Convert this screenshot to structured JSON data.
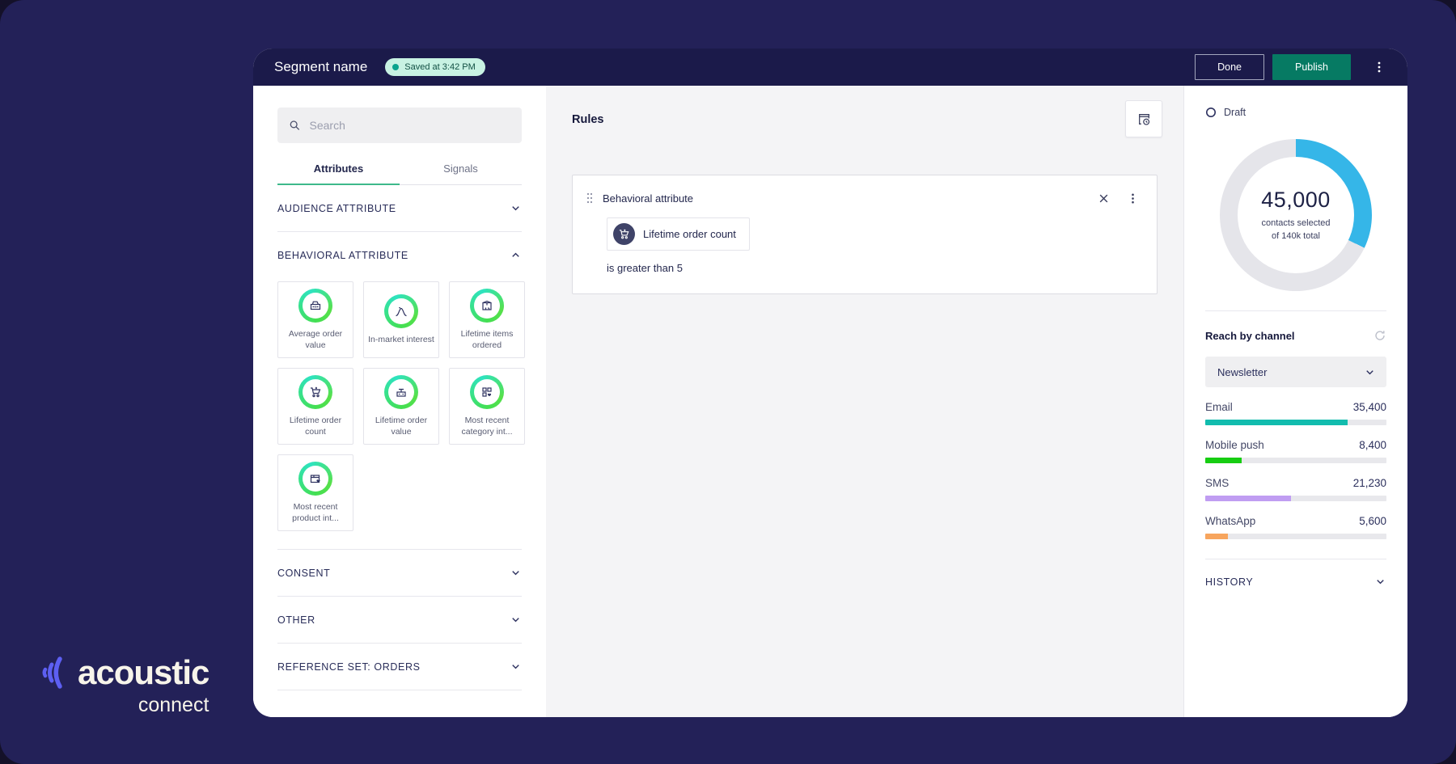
{
  "header": {
    "title": "Segment name",
    "saved_badge": "Saved at 3:42 PM",
    "done_label": "Done",
    "publish_label": "Publish"
  },
  "sidebar": {
    "search_placeholder": "Search",
    "tabs": {
      "attributes": "Attributes",
      "signals": "Signals"
    },
    "sections": {
      "audience": "AUDIENCE ATTRIBUTE",
      "behavioral": "BEHAVIORAL ATTRIBUTE",
      "consent": "CONSENT",
      "other": "OTHER",
      "reference": "REFERENCE SET: ORDERS"
    },
    "behavioral_tiles": [
      {
        "label": "Average order value",
        "icon": "cash-register-icon"
      },
      {
        "label": "In-market interest",
        "icon": "bell-curve-icon"
      },
      {
        "label": "Lifetime items ordered",
        "icon": "package-icon"
      },
      {
        "label": "Lifetime order count",
        "icon": "cart-icon"
      },
      {
        "label": "Lifetime order value",
        "icon": "register-value-icon"
      },
      {
        "label": "Most recent category int...",
        "icon": "category-heart-icon"
      },
      {
        "label": "Most recent product int...",
        "icon": "product-heart-icon"
      }
    ]
  },
  "rules": {
    "heading": "Rules",
    "card": {
      "type_label": "Behavioral attribute",
      "attribute_label": "Lifetime order count",
      "attribute_icon": "cart-icon",
      "condition": "is greater than 5"
    }
  },
  "summary": {
    "status": "Draft",
    "donut": {
      "value_label": "45,000",
      "line1": "contacts selected",
      "line2": "of 140k total",
      "selected": 45000,
      "total": 140000,
      "percent": 32.1,
      "color": "#35b6e8",
      "track_color": "#e5e5ea"
    },
    "reach": {
      "title": "Reach by channel",
      "dropdown_value": "Newsletter",
      "channels": [
        {
          "name": "Email",
          "value_label": "35,400",
          "value": 35400,
          "pct": 78.7,
          "color": "#12bcae"
        },
        {
          "name": "Mobile push",
          "value_label": "8,400",
          "value": 8400,
          "pct": 20.0,
          "color": "#17cd12"
        },
        {
          "name": "SMS",
          "value_label": "21,230",
          "value": 21230,
          "pct": 47.2,
          "color": "#c09df2"
        },
        {
          "name": "WhatsApp",
          "value_label": "5,600",
          "value": 5600,
          "pct": 12.4,
          "color": "#f7a55e"
        }
      ]
    },
    "history_label": "HISTORY"
  },
  "logo": {
    "brand": "acoustic",
    "product": "connect"
  }
}
